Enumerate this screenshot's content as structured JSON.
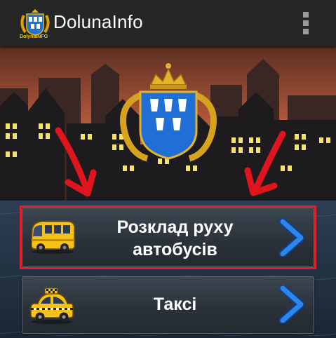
{
  "app": {
    "title": "DolunaInfo",
    "logo_caption": "DolynaINFO",
    "logo_icon": "coat-of-arms-icon",
    "menu_icon": "overflow-menu-icon"
  },
  "hero": {
    "emblem_icon": "dolyna-coat-of-arms",
    "arrows": [
      "red-arrow-down-right",
      "red-arrow-down-left"
    ]
  },
  "menu": {
    "items": [
      {
        "label_line1": "Розклад руху",
        "label_line2": "автобусів",
        "icon": "bus-icon",
        "chevron": "chevron-right-icon",
        "highlighted": true
      },
      {
        "label": "Таксі",
        "icon": "taxi-icon",
        "chevron": "chevron-right-icon",
        "highlighted": false
      }
    ]
  },
  "colors": {
    "appbar": "#262626",
    "accent_blue": "#1f6fd6",
    "highlight_red": "#e31c2a",
    "window_light": "#f4e36a"
  }
}
